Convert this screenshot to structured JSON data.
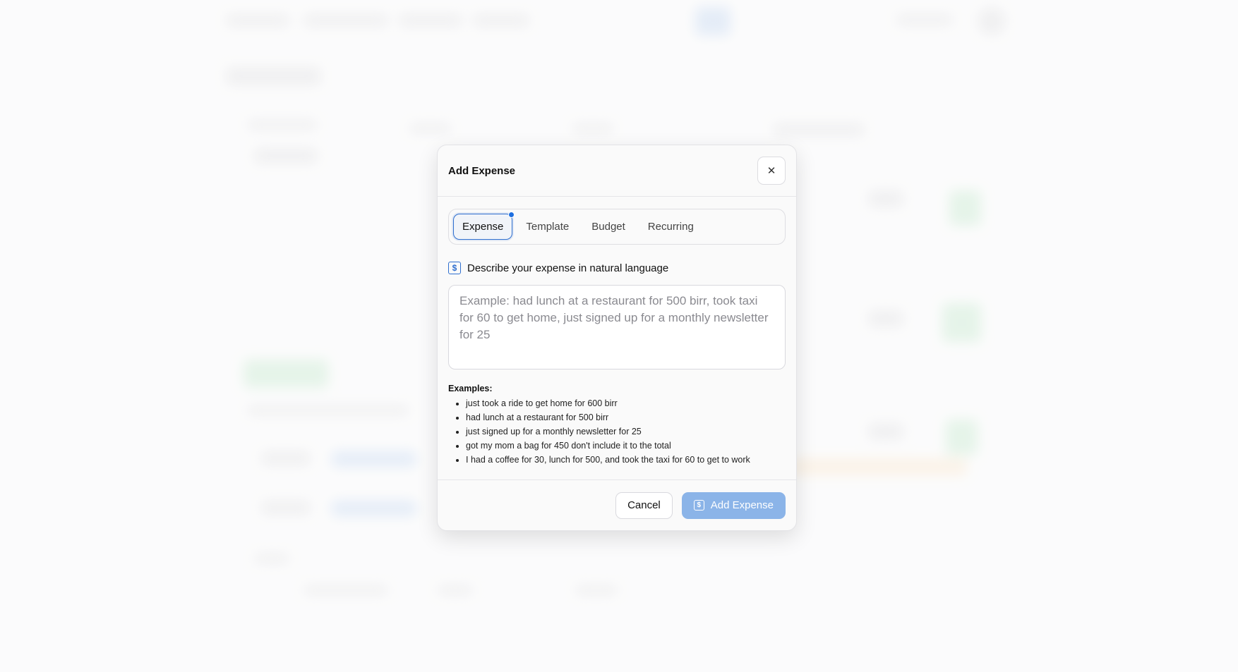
{
  "dialog": {
    "title": "Add Expense",
    "close_label": "✕",
    "tabs": [
      {
        "label": "Expense",
        "active": true
      },
      {
        "label": "Template",
        "active": false
      },
      {
        "label": "Budget",
        "active": false
      },
      {
        "label": "Recurring",
        "active": false
      }
    ],
    "section_label": "Describe your expense in natural language",
    "input": {
      "value": "",
      "placeholder": "Example: had lunch at a restaurant for 500 birr, took taxi for 60 to get home, just signed up for a monthly newsletter for 25"
    },
    "examples": {
      "title": "Examples:",
      "items": [
        "just took a ride to get home for 600 birr",
        "had lunch at a restaurant for 500 birr",
        "just signed up for a monthly newsletter for 25",
        "got my mom a bag for 450 don't include it to the total",
        "I had a coffee for 30, lunch for 500, and took the taxi for 60 to get to work"
      ]
    },
    "footer": {
      "cancel_label": "Cancel",
      "submit_label": "Add Expense"
    },
    "icons": {
      "money": "money-icon",
      "close": "close-icon"
    },
    "colors": {
      "accent": "#2f6fcf",
      "submit_disabled": "#8bb4e8"
    }
  }
}
